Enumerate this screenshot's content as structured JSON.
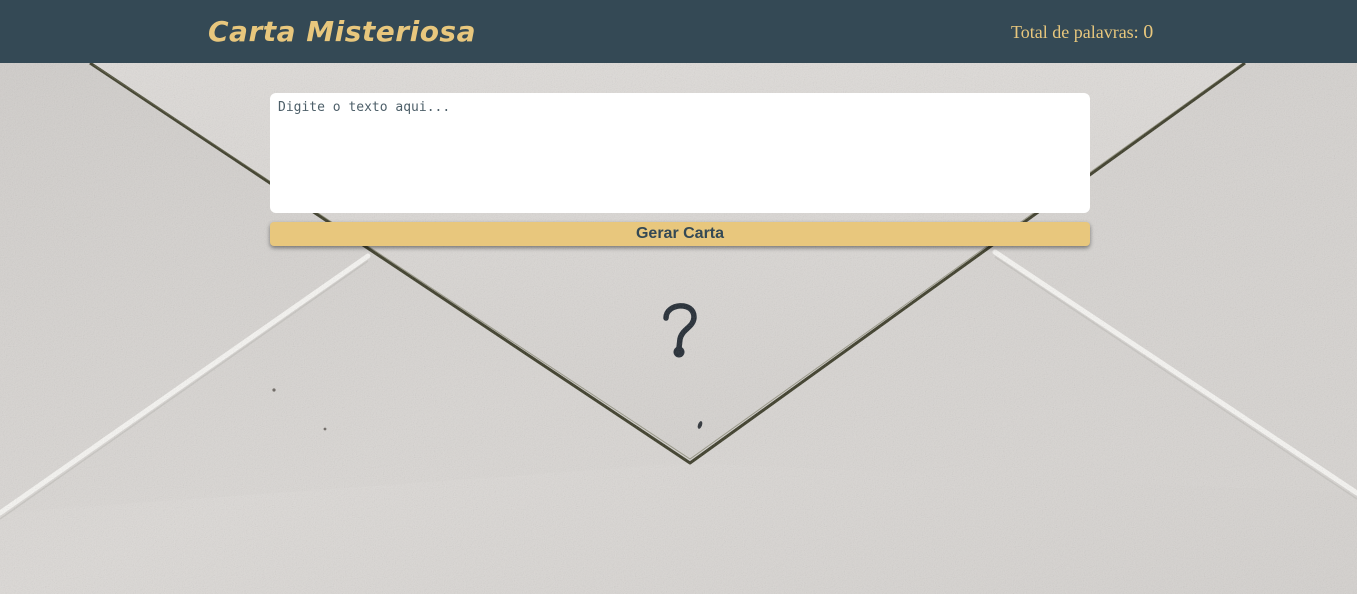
{
  "header": {
    "title": "Carta Misteriosa",
    "word_count_label": "Total de palavras:",
    "word_count_value": "0"
  },
  "editor": {
    "value": "",
    "placeholder": "Digite o texto aqui..."
  },
  "actions": {
    "generate_label": "Gerar Carta"
  },
  "background": {
    "image": "envelope-back-question-mark",
    "flap_mark": "?"
  },
  "colors": {
    "header_bg": "#344955",
    "accent": "#e8c77d",
    "button_text": "#344955"
  }
}
